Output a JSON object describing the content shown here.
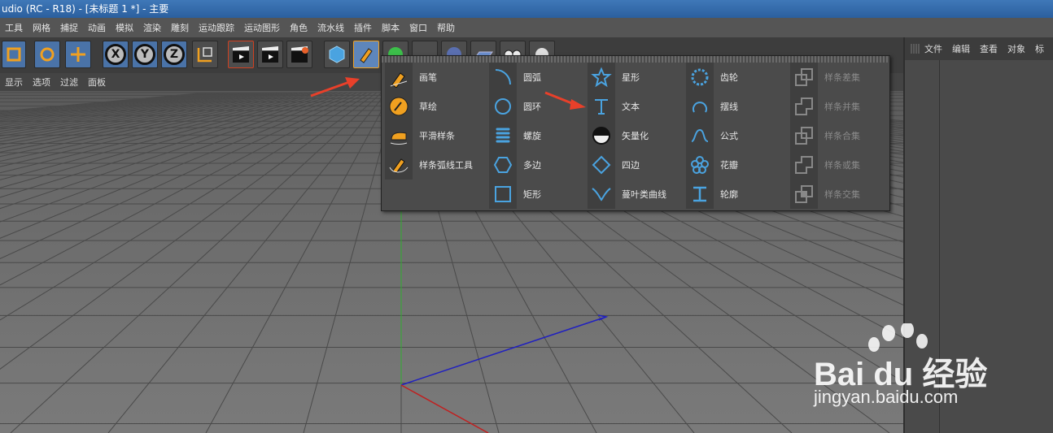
{
  "window": {
    "title": "udio (RC - R18) - [未标题 1 *] - 主要"
  },
  "menu": [
    "工具",
    "网格",
    "捕捉",
    "动画",
    "模拟",
    "渲染",
    "雕刻",
    "运动跟踪",
    "运动图形",
    "角色",
    "流水线",
    "插件",
    "脚本",
    "窗口",
    "帮助"
  ],
  "viewport_menu": [
    "显示",
    "选项",
    "过滤",
    "面板"
  ],
  "right_panel": {
    "menu": [
      "文件",
      "编辑",
      "查看",
      "对象",
      "标"
    ]
  },
  "axis_buttons": [
    "X",
    "Y",
    "Z"
  ],
  "spline_menu": {
    "col1": [
      "画笔",
      "草绘",
      "平滑样条",
      "样条弧线工具"
    ],
    "col2": [
      "圆弧",
      "圆环",
      "螺旋",
      "多边",
      "矩形"
    ],
    "col3": [
      "星形",
      "文本",
      "矢量化",
      "四边",
      "蔓叶类曲线"
    ],
    "col4": [
      "齿轮",
      "摆线",
      "公式",
      "花瓣",
      "轮廓"
    ],
    "col5": [
      "样条差集",
      "样条并集",
      "样条合集",
      "样条或集",
      "样条交集"
    ]
  },
  "watermark": {
    "brand": "Bai du 经验",
    "url": "jingyan.baidu.com"
  },
  "colors": {
    "accent": "#f0a020",
    "icon_blue": "#4aa3e0",
    "arrow": "#e8402a"
  }
}
